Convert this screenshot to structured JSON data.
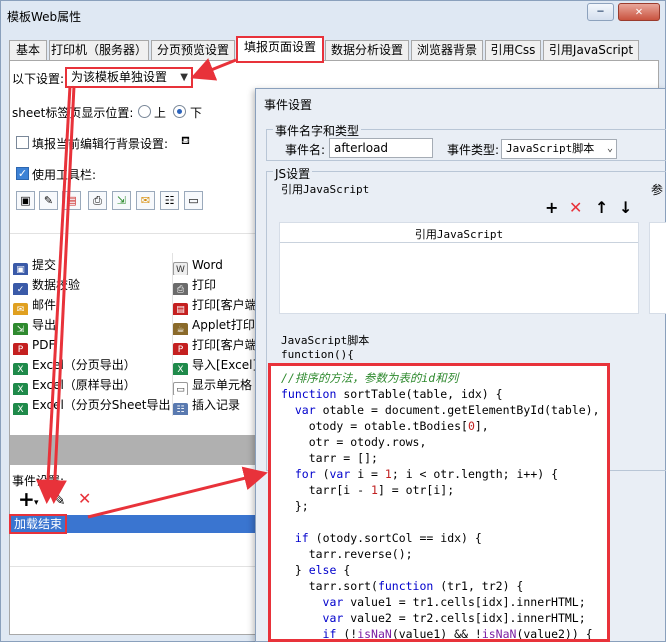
{
  "window": {
    "title": "模板Web属性",
    "minimize": "−",
    "close": "✕"
  },
  "tabs": [
    {
      "label": "基本"
    },
    {
      "label": "打印机（服务器）"
    },
    {
      "label": "分页预览设置"
    },
    {
      "label": "填报页面设置",
      "active": true
    },
    {
      "label": "数据分析设置"
    },
    {
      "label": "浏览器背景"
    },
    {
      "label": "引用Css"
    },
    {
      "label": "引用JavaScript"
    }
  ],
  "settings": {
    "following_label": "以下设置:",
    "mode_value": "为该模板单独设置",
    "sheet_position_label": "sheet标签页显示位置:",
    "radio_top": "上",
    "radio_bottom": "下",
    "fill_bg_label": "填报当前编辑行背景设置:",
    "use_toolbar_label": "使用工具栏:"
  },
  "toolbar_buttons": [
    {
      "icon": "submit-icon",
      "label": "提交",
      "col": 0
    },
    {
      "icon": "word-icon",
      "label": "Word",
      "col": 1
    },
    {
      "icon": "verify-icon",
      "label": "数据校验",
      "col": 0
    },
    {
      "icon": "print-icon",
      "label": "打印",
      "col": 1
    },
    {
      "icon": "mail-icon",
      "label": "邮件",
      "col": 0
    },
    {
      "icon": "print-client-icon",
      "label": "打印[客户端",
      "col": 1
    },
    {
      "icon": "export-icon",
      "label": "导出",
      "col": 0
    },
    {
      "icon": "applet-print-icon",
      "label": "Applet打印",
      "col": 1
    },
    {
      "icon": "pdf-icon",
      "label": "PDF",
      "col": 0
    },
    {
      "icon": "print-client-pdf-icon",
      "label": "打印[客户端",
      "col": 1
    },
    {
      "icon": "excel-icon",
      "label": "Excel（分页导出）",
      "col": 0
    },
    {
      "icon": "import-excel-icon",
      "label": "导入[Excel]",
      "col": 1
    },
    {
      "icon": "excel-icon",
      "label": "Excel（原样导出）",
      "col": 0
    },
    {
      "icon": "cell-display-icon",
      "label": "显示单元格",
      "col": 1
    },
    {
      "icon": "excel-icon",
      "label": "Excel（分页分Sheet导出）",
      "col": 0
    },
    {
      "icon": "insert-record-icon",
      "label": "插入记录",
      "col": 1
    }
  ],
  "events": {
    "label": "事件设置:",
    "selected_event": "加载结束"
  },
  "dialog": {
    "title": "事件设置",
    "name_group_title": "事件名字和类型",
    "event_name_label": "事件名:",
    "event_name_value": "afterload",
    "event_type_label": "事件类型:",
    "event_type_value": "JavaScript脚本",
    "js_group_title": "JS设置",
    "ref_js_label": "引用JavaScript",
    "param_label": "参",
    "ref_js_header": "引用JavaScript",
    "script_label": "JavaScript脚本",
    "function_line": "function(){"
  },
  "code_lines": [
    "//排序的方法，参数为表的id和列",
    "function sortTable(table, idx) {",
    "  var otable = document.getElementById(table),",
    "    otody = otable.tBodies[0],",
    "    otr = otody.rows,",
    "    tarr = [];",
    "  for (var i = 1; i < otr.length; i++) {",
    "    tarr[i - 1] = otr[i];",
    "  };",
    "",
    "  if (otody.sortCol == idx) {",
    "    tarr.reverse();",
    "  } else {",
    "    tarr.sort(function (tr1, tr2) {",
    "      var value1 = tr1.cells[idx].innerHTML;",
    "      var value2 = tr2.cells[idx].innerHTML;",
    "      if (!isNaN(value1) && !isNaN(value2)) {"
  ],
  "colors": {
    "highlight": "#e8323a",
    "selection": "#3a75d0",
    "window_bg": "#dfe8f3"
  }
}
